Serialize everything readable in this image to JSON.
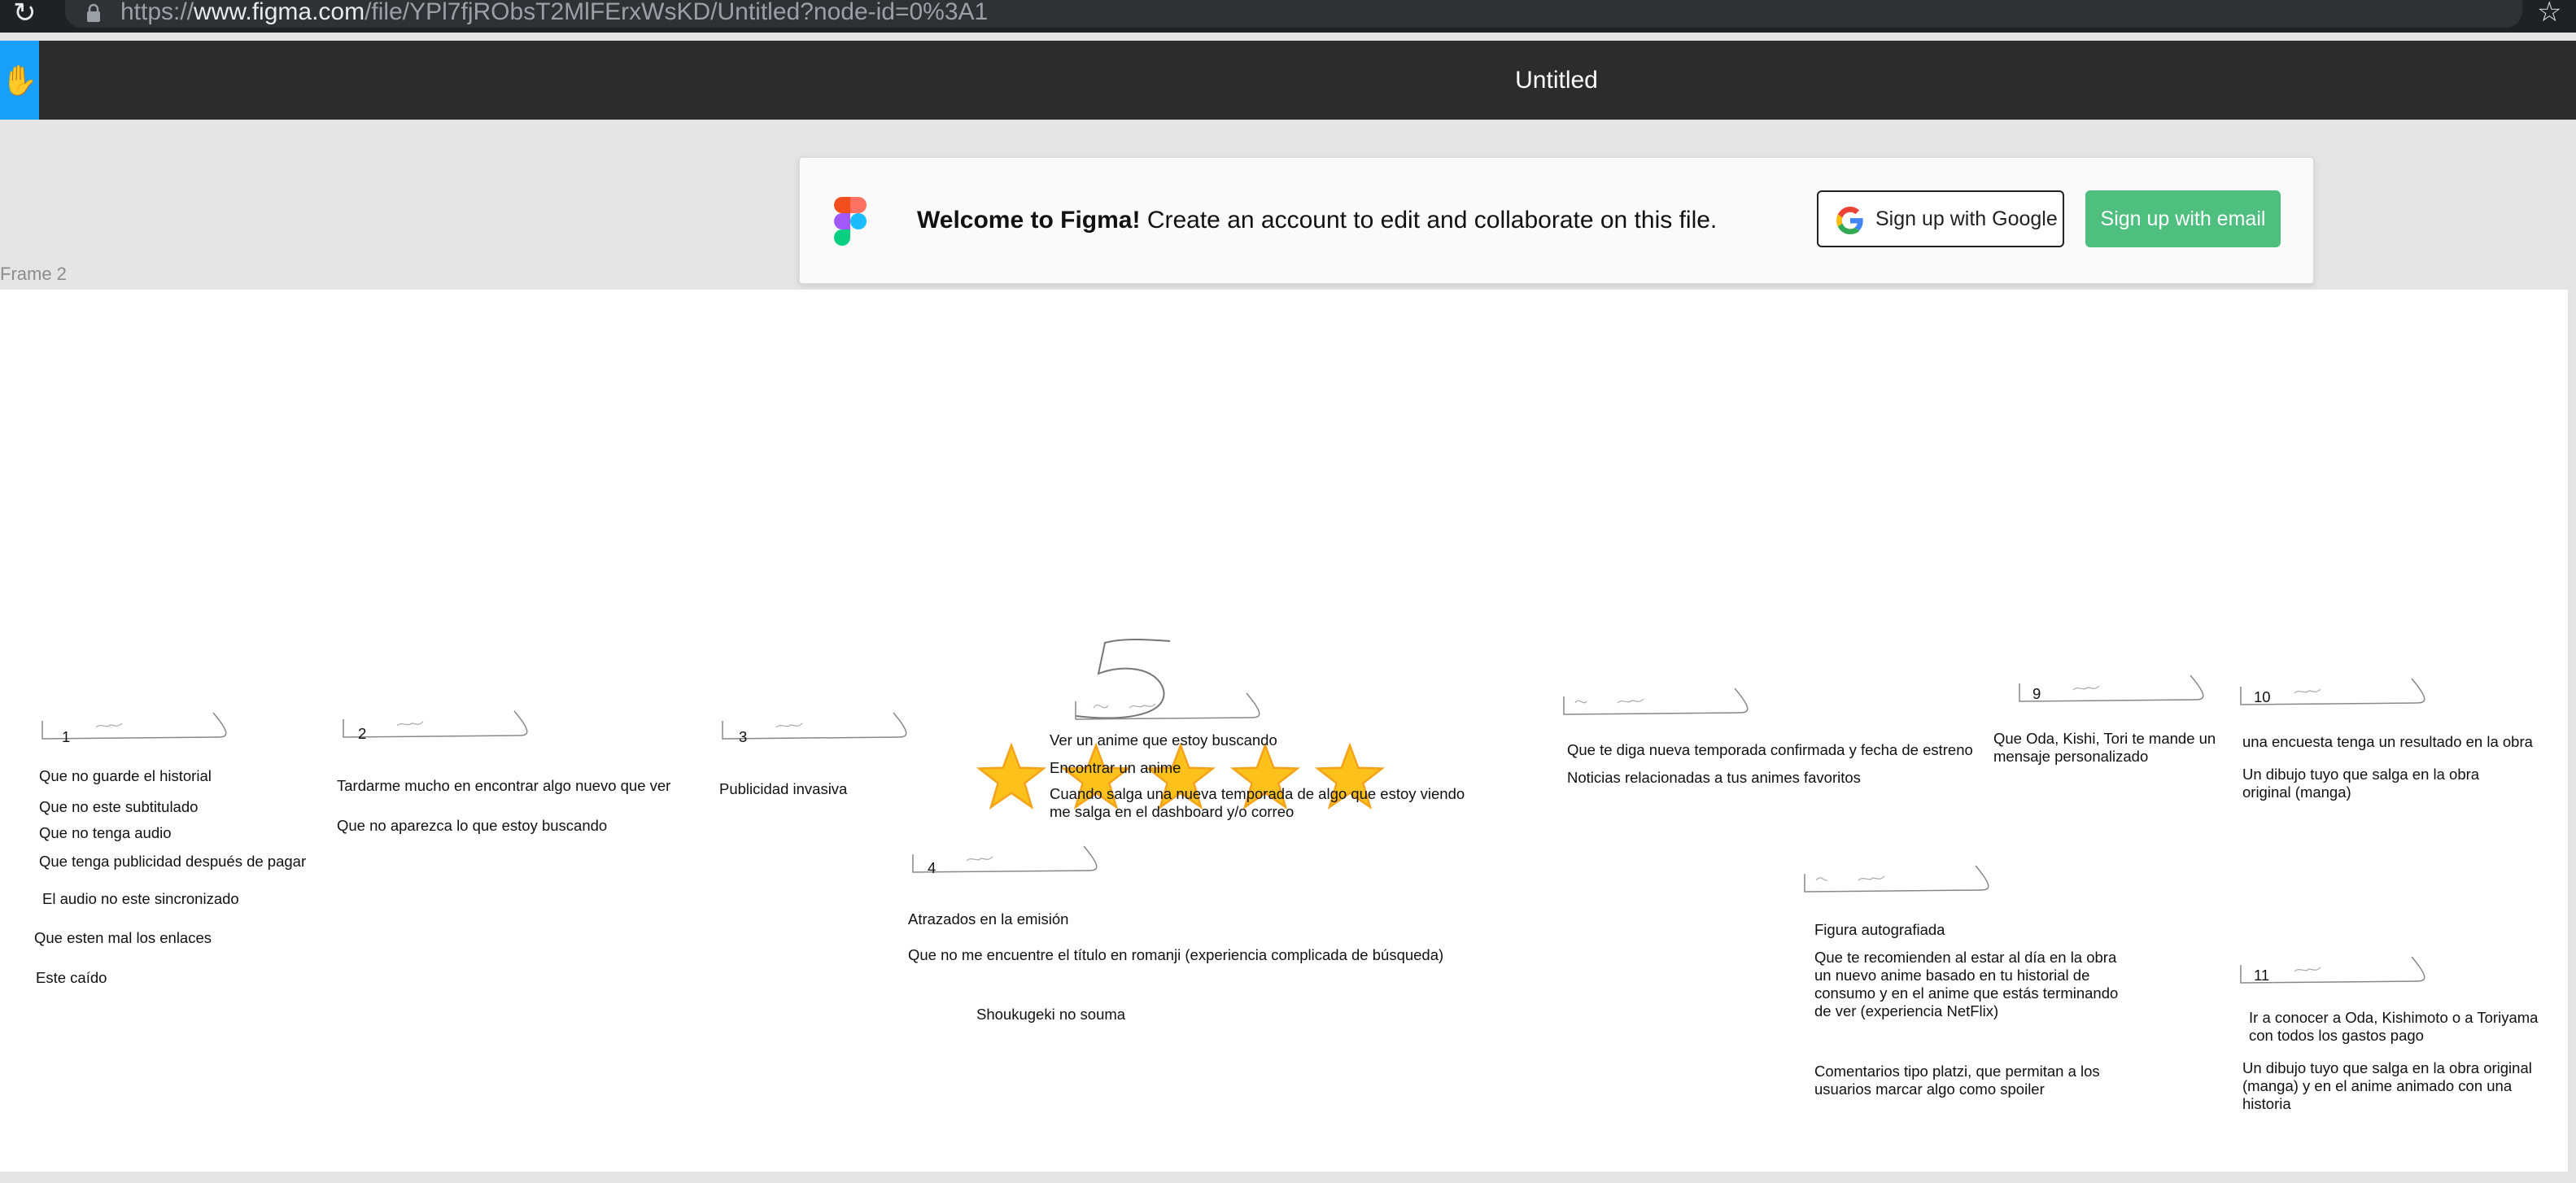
{
  "browser": {
    "url_host_prefix": "https://",
    "url_host": "www.figma.com",
    "url_path": "/file/YPl7fjRObsT2MlFErxWsKD/Untitled?node-id=0%3A1",
    "reload_icon": "reload-icon",
    "bookmark_icon": "star-outline-icon"
  },
  "toolbar": {
    "title": "Untitled",
    "tool_icon": "hand-icon",
    "tool_color": "#18a0fb"
  },
  "welcome": {
    "bold": "Welcome to Figma!",
    "text": " Create an account to edit and collaborate on this file.",
    "google_button": "Sign up with Google",
    "email_button": "Sign up with email",
    "email_button_color": "#4ebf7e"
  },
  "frame": {
    "label": "Frame 2"
  },
  "rating": {
    "stars": 5,
    "max": 5
  },
  "columns": {
    "c1": {
      "num": "1",
      "items": [
        "Que no guarde el historial",
        "Que no este subtitulado",
        "Que no tenga audio",
        "Que tenga publicidad después de pagar",
        "El audio no este sincronizado",
        "Que esten mal los enlaces",
        "Este caído"
      ]
    },
    "c2": {
      "num": "2",
      "items": [
        "Tardarme mucho en encontrar algo nuevo que ver",
        "Que no aparezca lo que estoy buscando"
      ]
    },
    "c3": {
      "num": "3",
      "items": [
        "Publicidad invasiva"
      ]
    },
    "c4": {
      "num": "4",
      "items": [
        "Atrazados en la emisión",
        "Que no me encuentre el título en romanji (experiencia complicada de búsqueda)",
        "Shoukugeki no souma"
      ]
    },
    "c5": {
      "items": [
        "Ver un anime que estoy buscando",
        "Encontrar un anime",
        "Cuando salga una nueva temporada de algo que estoy viendo me salga en el dashboard y/o correo"
      ]
    },
    "c6": {
      "items": [
        "Que te diga nueva temporada confirmada y fecha de estreno",
        "Noticias relacionadas a tus animes favoritos"
      ]
    },
    "c7": {
      "items": [
        "Figura autografiada",
        "Que te recomienden al estar al día en la obra un nuevo anime basado en tu historial de consumo y en el anime que estás terminando de ver (experiencia NetFlix)",
        "Comentarios tipo platzi, que permitan a los usuarios marcar algo como spoiler"
      ]
    },
    "c9": {
      "num": "9",
      "items": [
        "Que Oda, Kishi, Tori te mande un mensaje personalizado"
      ]
    },
    "c10": {
      "num": "10",
      "items": [
        "una encuesta tenga un resultado en la obra",
        "Un dibujo tuyo que salga en la obra original (manga)"
      ]
    },
    "c11": {
      "num": "11",
      "items": [
        "Ir a conocer a Oda, Kishimoto o a Toriyama con todos los gastos pago",
        "Un dibujo tuyo que salga en la obra original (manga) y en el anime animado con una historia"
      ]
    }
  }
}
